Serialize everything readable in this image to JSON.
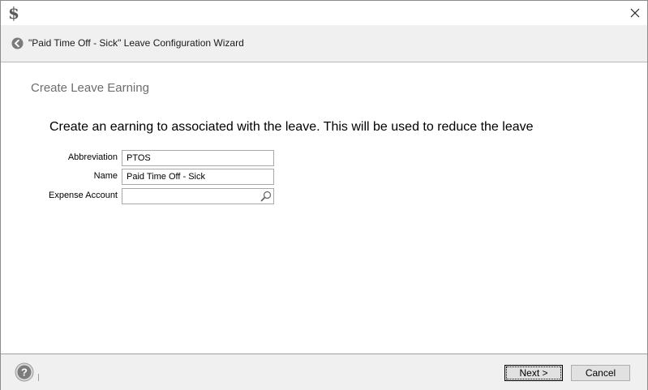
{
  "window": {
    "app_icon": "dollar-sign-icon",
    "close_icon": "close-icon"
  },
  "header": {
    "back_icon": "back-arrow-circle-icon",
    "title": "\"Paid Time Off - Sick\" Leave Configuration Wizard"
  },
  "step": {
    "title": "Create Leave Earning",
    "instruction": "Create an earning to associated with the leave. This will be used to reduce the leave"
  },
  "form": {
    "abbreviation": {
      "label": "Abbreviation",
      "value": "PTOS"
    },
    "name": {
      "label": "Name",
      "value": "Paid Time Off - Sick"
    },
    "expense_account": {
      "label": "Expense Account",
      "value": "",
      "lookup_icon": "magnifier-icon"
    }
  },
  "footer": {
    "help_icon": "help-question-icon",
    "next_label": "Next >",
    "cancel_label": "Cancel"
  }
}
